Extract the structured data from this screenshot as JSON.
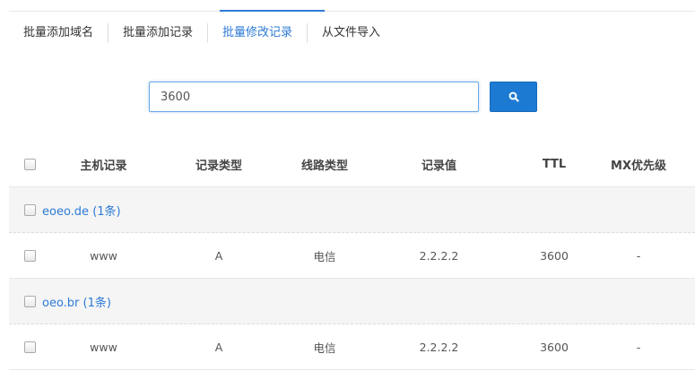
{
  "tabs": [
    {
      "label": "批量添加域名",
      "active": false
    },
    {
      "label": "批量添加记录",
      "active": false
    },
    {
      "label": "批量修改记录",
      "active": true
    },
    {
      "label": "从文件导入",
      "active": false
    }
  ],
  "search": {
    "value": "3600",
    "button_icon": "search-icon"
  },
  "table": {
    "headers": {
      "host": "主机记录",
      "type": "记录类型",
      "line": "线路类型",
      "value": "记录值",
      "ttl": "TTL",
      "mx": "MX优先级"
    },
    "groups": [
      {
        "label": "eoeo.de (1条)",
        "rows": [
          {
            "host": "www",
            "type": "A",
            "line": "电信",
            "value": "2.2.2.2",
            "ttl": "3600",
            "mx": "-"
          }
        ]
      },
      {
        "label": "oeo.br (1条)",
        "rows": [
          {
            "host": "www",
            "type": "A",
            "line": "电信",
            "value": "2.2.2.2",
            "ttl": "3600",
            "mx": "-"
          }
        ]
      }
    ]
  },
  "colors": {
    "accent": "#2d7ad6",
    "button": "#1d7ad3"
  }
}
